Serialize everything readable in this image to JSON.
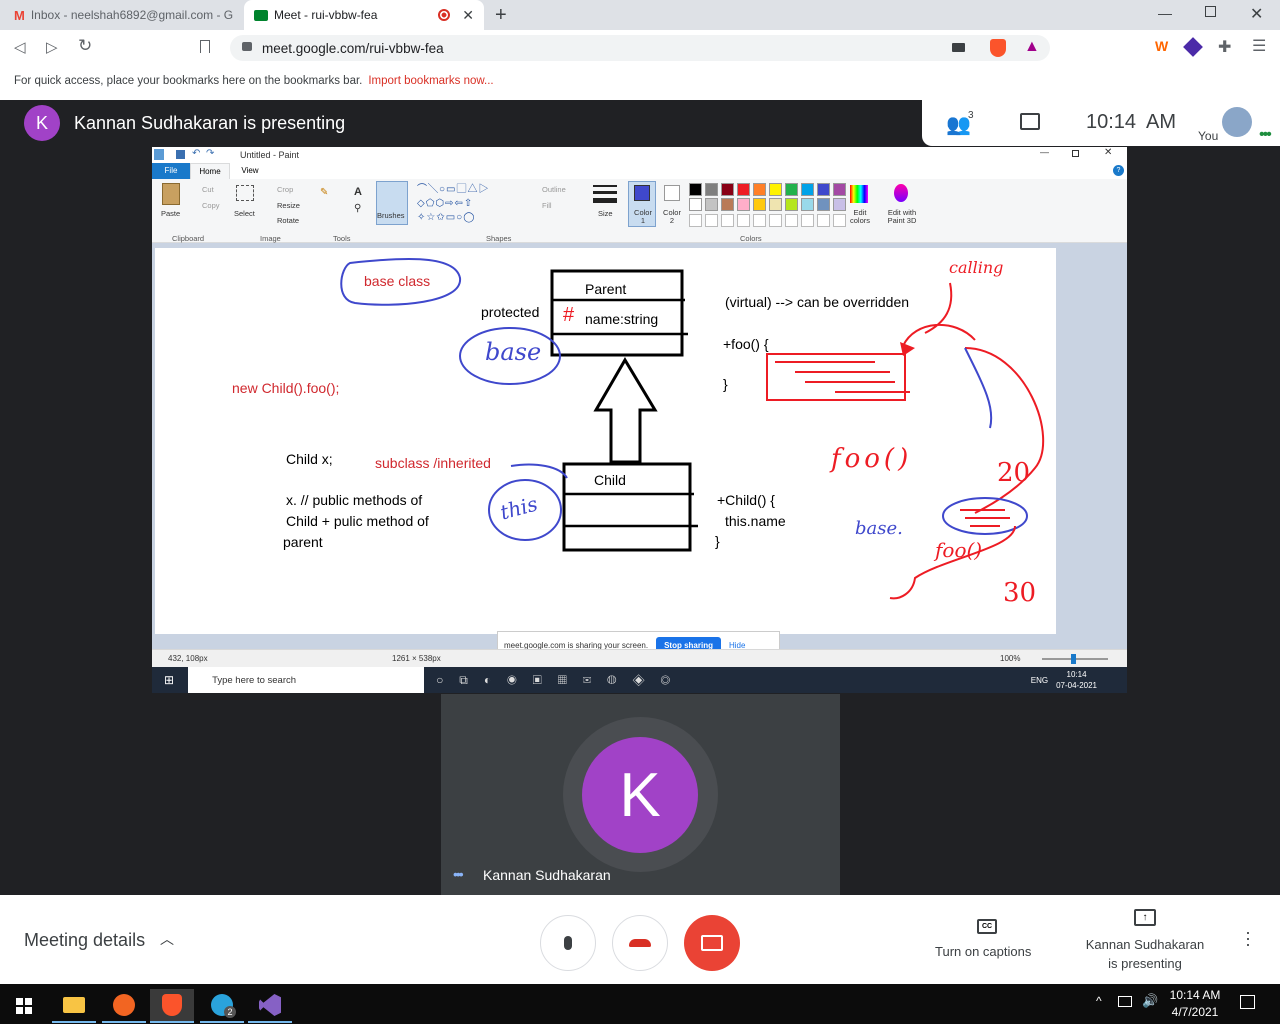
{
  "browser": {
    "tabs": [
      {
        "title": "Inbox - neelshah6892@gmail.com - G"
      },
      {
        "title": "Meet - rui-vbbw-fea"
      }
    ],
    "url": "meet.google.com/rui-vbbw-fea",
    "bookmarks_bar": {
      "text": "For quick access, place your bookmarks here on the bookmarks bar.",
      "link": "Import bookmarks now..."
    }
  },
  "meet": {
    "presenter_text": "Kannan Sudhakaran is presenting",
    "presenter_initial": "K",
    "participants_count": "3",
    "time": "10:14  AM",
    "self_label": "You",
    "tile_name": "Kannan Sudhakaran",
    "tile_initial": "K",
    "meeting_details": "Meeting details",
    "captions_label": "Turn on captions",
    "presenting_label": "Kannan Sudhakaran is presenting"
  },
  "paint": {
    "title": "Untitled - Paint",
    "tabs": [
      "File",
      "Home",
      "View"
    ],
    "groups": {
      "clipboard": "Clipboard",
      "image": "Image",
      "tools": "Tools",
      "shapes": "Shapes",
      "colors": "Colors"
    },
    "buttons": {
      "paste": "Paste",
      "cut": "Cut",
      "copy": "Copy",
      "select": "Select",
      "crop": "Crop",
      "resize": "Resize",
      "rotate": "Rotate",
      "brushes": "Brushes",
      "outline": "Outline",
      "fill": "Fill",
      "size": "Size",
      "color1": "Color 1",
      "color2": "Color 2",
      "edit_colors": "Edit colors",
      "edit_paint3d": "Edit with Paint 3D"
    },
    "palette": [
      "#000000",
      "#7f7f7f",
      "#880015",
      "#ed1c24",
      "#ff7f27",
      "#fff200",
      "#22b14c",
      "#00a2e8",
      "#3f48cc",
      "#a349a4",
      "#ffffff",
      "#c3c3c3",
      "#b97a57",
      "#ffaec9",
      "#ffc90e",
      "#efe4b0",
      "#b5e61d",
      "#99d9ea",
      "#7092be",
      "#c8bfe7"
    ],
    "status": {
      "cursor": "432, 108px",
      "size": "1261 × 538px",
      "zoom": "100%"
    },
    "share_banner": {
      "text": "meet.google.com is sharing your screen.",
      "stop": "Stop sharing",
      "hide": "Hide"
    },
    "inner_taskbar": {
      "search": "Type here to search",
      "lang": "ENG",
      "time": "10:14",
      "date": "07-04-2021"
    },
    "canvas": {
      "base_class": "base class",
      "parent_title": "Parent",
      "protected": "protected",
      "hash": "#",
      "name_field": "name:string",
      "virtual": "(virtual) --> can be overridden",
      "foo_open": "+foo() {",
      "close1": "}",
      "new_child": "new Child().foo();",
      "child_x": "Child x;",
      "subclass": "subclass /inherited",
      "child_title": "Child",
      "x_public": "x. // public methods of",
      "child_plus": "Child + pulic method of",
      "parent_word": "parent",
      "child_ctor": "+Child() {",
      "this_name": "this.name",
      "close2": "}",
      "hw_base": "base",
      "hw_this": "this",
      "hw_calling": "calling",
      "hw_foo": "foo()",
      "hw_20": "20",
      "hw_base2": "base.",
      "hw_foo2": "foo()",
      "hw_30": "30"
    }
  },
  "windows_taskbar": {
    "time": "10:14 AM",
    "date": "4/7/2021",
    "telegram_badge": "2"
  },
  "colors": {
    "meet_bg": "#202124",
    "avatar": "#a142c7",
    "end_call": "#ea4335",
    "accent_blue": "#1a73e8"
  }
}
